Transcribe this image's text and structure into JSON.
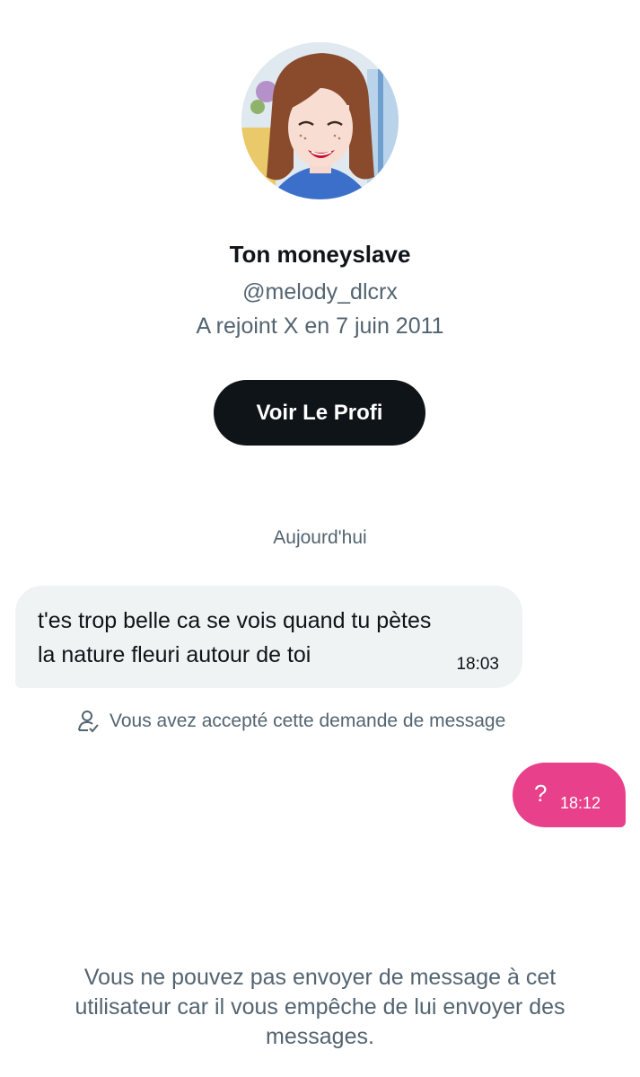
{
  "profile": {
    "display_name": "Ton moneyslave",
    "handle": "@melody_dlcrx",
    "joined": "A rejoint X en 7 juin 2011",
    "profile_button_label": "Voir Le Profi",
    "avatar_icon": "cartoon-avatar"
  },
  "conversation": {
    "date_label": "Aujourd'hui",
    "incoming_message": {
      "text": "t'es trop belle ca se vois quand tu pètes\nla nature fleuri autour de toi",
      "time": "18:03"
    },
    "accepted_notice": {
      "icon": "person-check-icon",
      "text": "Vous avez accepté cette demande de message"
    },
    "outgoing_message": {
      "text": "?",
      "time": "18:12"
    }
  },
  "footer": {
    "blocked_notice": "Vous ne pouvez pas envoyer de message à cet utilisateur car il vous empêche de lui envoyer des messages."
  },
  "colors": {
    "outgoing_bubble": "#e8408a",
    "incoming_bubble": "#eff3f4",
    "button_bg": "#0f1419",
    "secondary_text": "#536471"
  }
}
